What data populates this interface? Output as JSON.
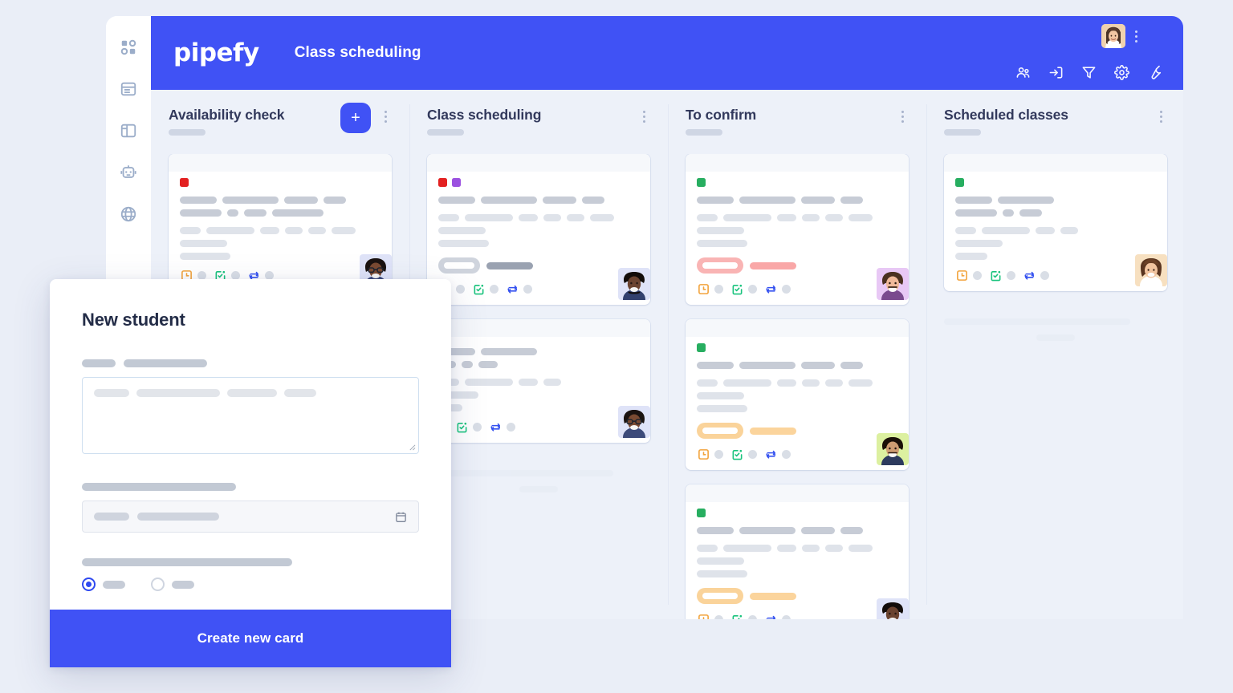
{
  "app": {
    "logo_text": "pipefy",
    "board_title": "Class scheduling",
    "brand_color": "#4052f5",
    "board_bg": "#edf1f9",
    "page_bg": "#eaeef7"
  },
  "sidebar": {
    "items": [
      {
        "icon": "grid-dashboard-icon",
        "name": "sidebar-item-dashboard"
      },
      {
        "icon": "database-list-icon",
        "name": "sidebar-item-database"
      },
      {
        "icon": "layout-panel-icon",
        "name": "sidebar-item-portals"
      },
      {
        "icon": "robot-automation-icon",
        "name": "sidebar-item-automation"
      },
      {
        "icon": "globe-icon",
        "name": "sidebar-item-public"
      }
    ]
  },
  "topbar": {
    "tools": [
      {
        "icon": "members-icon",
        "name": "members-button"
      },
      {
        "icon": "inbox-import-icon",
        "name": "import-button"
      },
      {
        "icon": "filter-icon",
        "name": "filter-button"
      },
      {
        "icon": "gear-icon",
        "name": "settings-button"
      },
      {
        "icon": "wrench-icon",
        "name": "tools-button"
      }
    ],
    "avatar": "user-avatar",
    "menu": "more-options-icon"
  },
  "board": {
    "columns": [
      {
        "title": "Availability check",
        "has_add_button": true,
        "add_label": "+",
        "cards": [
          {
            "labels": [
              "#e32121"
            ],
            "badge": null,
            "avatar_bg": "#dfe3f8",
            "avatar_skin": "#6b4330",
            "avatar_hair": "#241a14",
            "avatar_glasses": true,
            "icons": [
              "clock-orange-icon",
              "checklist-green-icon",
              "connection-blue-icon"
            ]
          }
        ],
        "loadmore": false
      },
      {
        "title": "Class scheduling",
        "has_add_button": false,
        "cards": [
          {
            "labels": [
              "#e32121",
              "#9b51e0"
            ],
            "badge": {
              "color": "#cfd4dd",
              "bar": "#9aa2b1"
            },
            "avatar_bg": "#dfe3f8",
            "avatar_skin": "#6b4330",
            "avatar_hair": "#1c1310",
            "avatar_glasses": false,
            "icons": [
              "clock-orange-icon",
              "checklist-green-icon",
              "connection-blue-icon"
            ]
          },
          {
            "labels": [],
            "badge": null,
            "avatar_bg": "#dfe3f8",
            "avatar_skin": "#6b4330",
            "avatar_hair": "#241a14",
            "avatar_glasses": true,
            "icons": [
              "checklist-green-icon",
              "connection-blue-icon"
            ]
          }
        ],
        "loadmore": true
      },
      {
        "title": "To confirm",
        "has_add_button": false,
        "cards": [
          {
            "labels": [
              "#27ae60"
            ],
            "badge": {
              "color": "#f9b4b4",
              "bar": "#f9a7a7"
            },
            "avatar_bg": "#e8c8f5",
            "avatar_skin": "#e8b597",
            "avatar_hair": "#3b2418",
            "avatar_glasses": false,
            "icons": [
              "clock-orange-icon",
              "checklist-green-icon",
              "connection-blue-icon"
            ]
          },
          {
            "labels": [
              "#27ae60"
            ],
            "badge": {
              "color": "#fad39a",
              "bar": "#fbd49c"
            },
            "avatar_bg": "#dcf0a0",
            "avatar_skin": "#cf9d72",
            "avatar_hair": "#241a14",
            "avatar_glasses": false,
            "icons": [
              "clock-orange-icon",
              "checklist-green-icon",
              "connection-blue-icon"
            ]
          },
          {
            "labels": [
              "#27ae60"
            ],
            "badge": {
              "color": "#fad39a",
              "bar": "#fbd49c"
            },
            "avatar_bg": "#dfe3f8",
            "avatar_skin": "#6b4330",
            "avatar_hair": "#1c1310",
            "avatar_glasses": false,
            "icons": [
              "clock-orange-icon",
              "checklist-green-icon",
              "connection-blue-icon"
            ]
          }
        ],
        "loadmore": false
      },
      {
        "title": "Scheduled classes",
        "has_add_button": false,
        "cards": [
          {
            "labels": [
              "#27ae60"
            ],
            "badge": null,
            "avatar_bg": "#f7e0c0",
            "avatar_skin": "#eebb99",
            "avatar_hair": "#4a2c18",
            "avatar_glasses": false,
            "icons": [
              "clock-orange-icon",
              "checklist-green-icon",
              "connection-blue-icon"
            ]
          }
        ],
        "loadmore": true
      }
    ]
  },
  "modal": {
    "title": "New student",
    "submit_label": "Create new card",
    "fields": [
      {
        "type": "textarea",
        "name": "description-field"
      },
      {
        "type": "date",
        "name": "date-field",
        "icon": "calendar-icon"
      },
      {
        "type": "radio-group",
        "name": "option-group",
        "selected_index": 0,
        "option_count": 2
      }
    ]
  }
}
